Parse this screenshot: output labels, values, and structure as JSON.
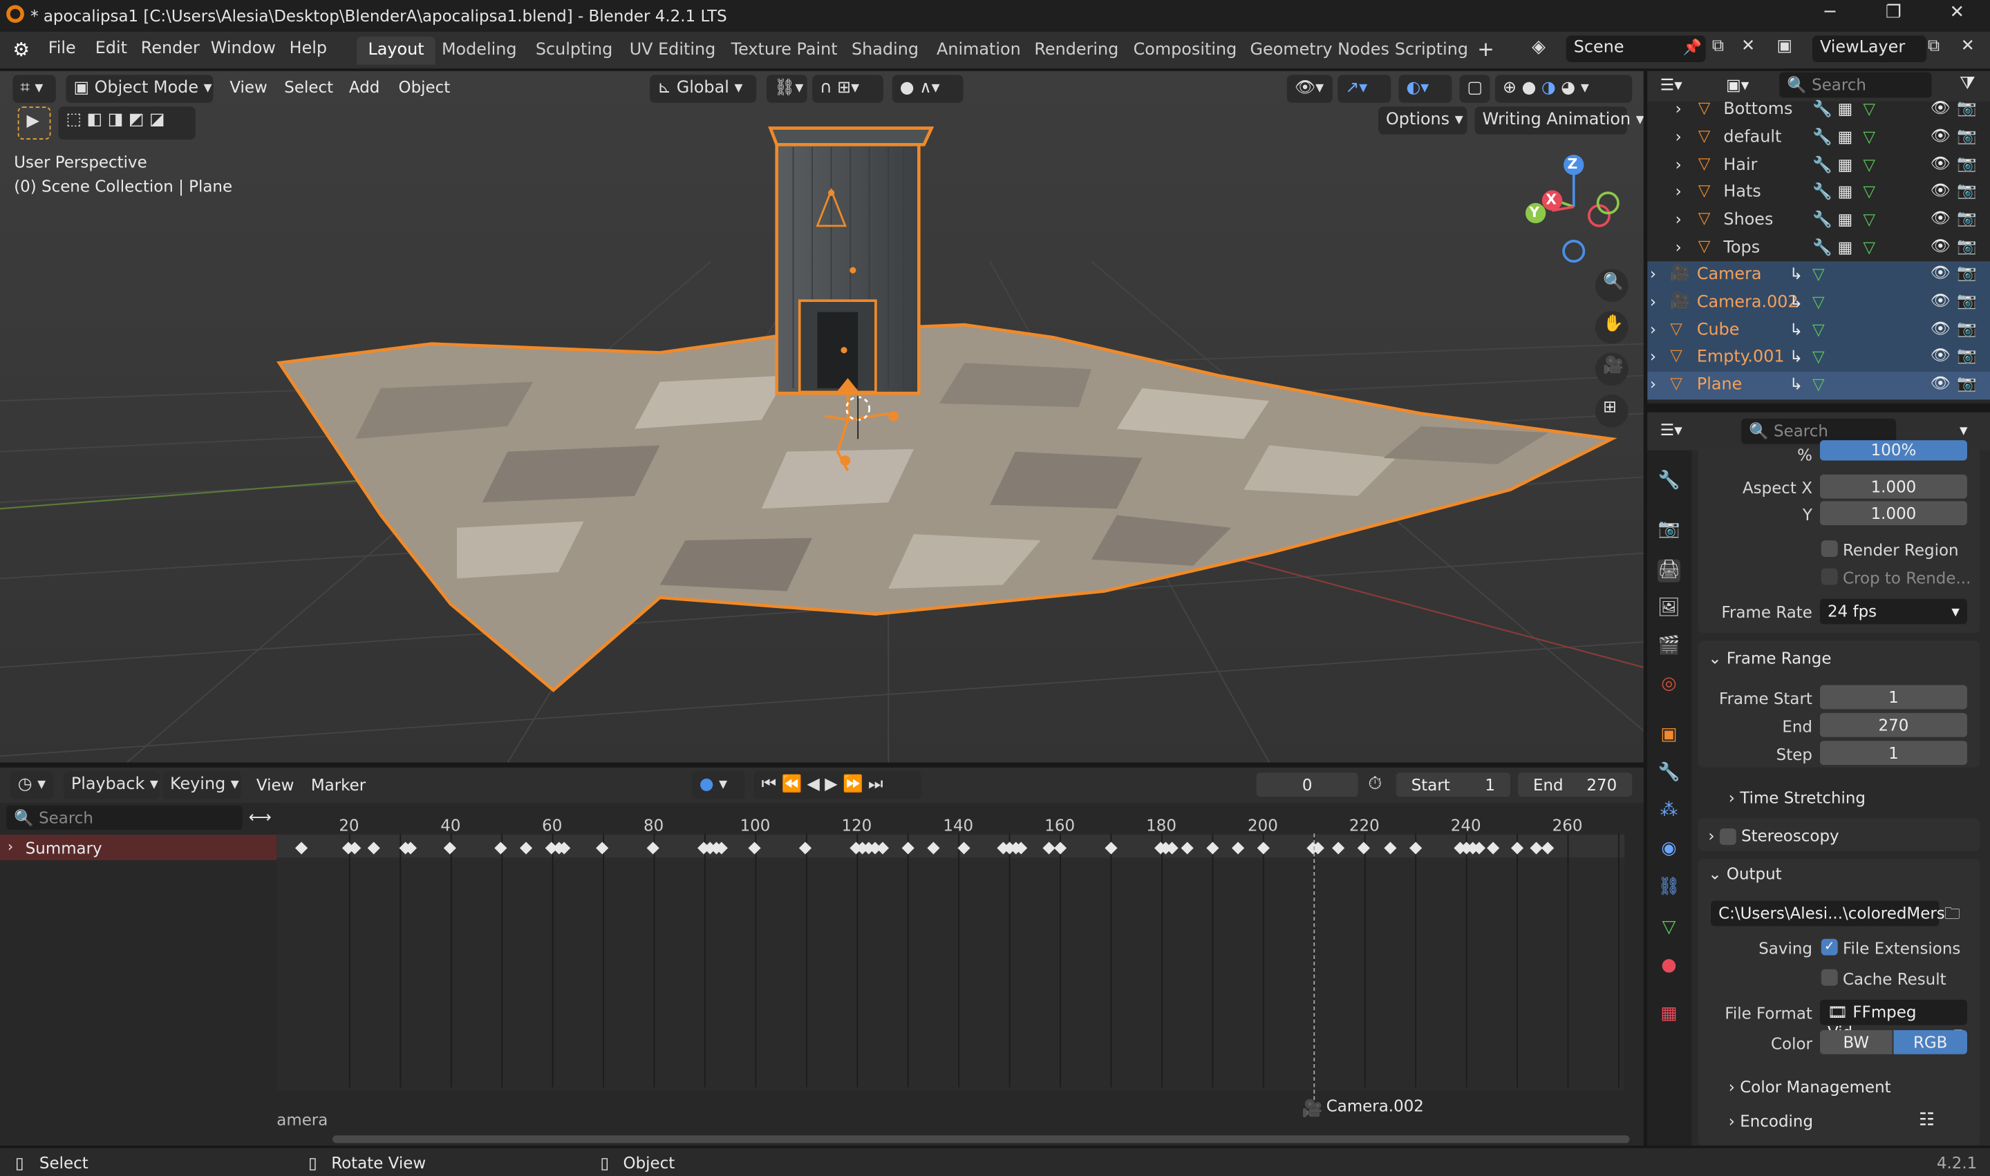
{
  "window": {
    "title": "* apocalipsa1 [C:\\Users\\Alesia\\Desktop\\BlenderA\\apocalipsa1.blend] - Blender 4.2.1 LTS"
  },
  "menu": [
    "File",
    "Edit",
    "Render",
    "Window",
    "Help"
  ],
  "workspaces": [
    "Layout",
    "Modeling",
    "Sculpting",
    "UV Editing",
    "Texture Paint",
    "Shading",
    "Animation",
    "Rendering",
    "Compositing",
    "Geometry Nodes",
    "Scripting"
  ],
  "active_workspace": "Layout",
  "scene_name": "Scene",
  "view_layer": "ViewLayer",
  "viewport": {
    "mode": "Object Mode",
    "menus": [
      "View",
      "Select",
      "Add",
      "Object"
    ],
    "transform_orientation": "Global",
    "options_label": "Options",
    "writing_animation": "Writing Animation",
    "perspective": "User Perspective",
    "collection_info": "(0) Scene Collection | Plane",
    "axes": {
      "x": "X",
      "y": "Y",
      "z": "Z"
    }
  },
  "timeline": {
    "menus": [
      "Playback",
      "Keying",
      "View",
      "Marker"
    ],
    "current_frame": "0",
    "start_label": "Start",
    "start_value": "1",
    "end_label": "End",
    "end_value": "270",
    "search_placeholder": "Search",
    "summary_label": "Summary",
    "ticks": [
      "20",
      "40",
      "60",
      "80",
      "100",
      "120",
      "140",
      "160",
      "180",
      "200",
      "220",
      "240",
      "260"
    ],
    "left_marker": "amera",
    "camera_marker": "Camera.002"
  },
  "outliner": {
    "search_placeholder": "Search",
    "collections": [
      "Bottoms",
      "default",
      "Hair",
      "Hats",
      "Shoes",
      "Tops"
    ],
    "objects": [
      "Camera",
      "Camera.002",
      "Cube",
      "Empty.001",
      "Plane"
    ]
  },
  "properties": {
    "search_placeholder": "Search",
    "percent": "100%",
    "aspect_x_label": "Aspect X",
    "aspect_x": "1.000",
    "aspect_y_label": "Y",
    "aspect_y": "1.000",
    "render_region": "Render Region",
    "crop_region": "Crop to Rende...",
    "frame_rate_label": "Frame Rate",
    "frame_rate": "24 fps",
    "frame_range_header": "Frame Range",
    "frame_start_label": "Frame Start",
    "frame_start": "1",
    "end_label": "End",
    "end": "270",
    "step_label": "Step",
    "step": "1",
    "time_stretching": "Time Stretching",
    "stereoscopy": "Stereoscopy",
    "output_header": "Output",
    "output_path": "C:\\Users\\Alesi...\\coloredMers",
    "saving_label": "Saving",
    "file_extensions": "File Extensions",
    "cache_result": "Cache Result",
    "file_format_label": "File Format",
    "file_format": "FFmpeg Vid...",
    "color_label": "Color",
    "color_bw": "BW",
    "color_rgb": "RGB",
    "color_management": "Color Management",
    "encoding": "Encoding"
  },
  "status": {
    "select": "Select",
    "rotate": "Rotate View",
    "object": "Object",
    "version": "4.2.1"
  }
}
